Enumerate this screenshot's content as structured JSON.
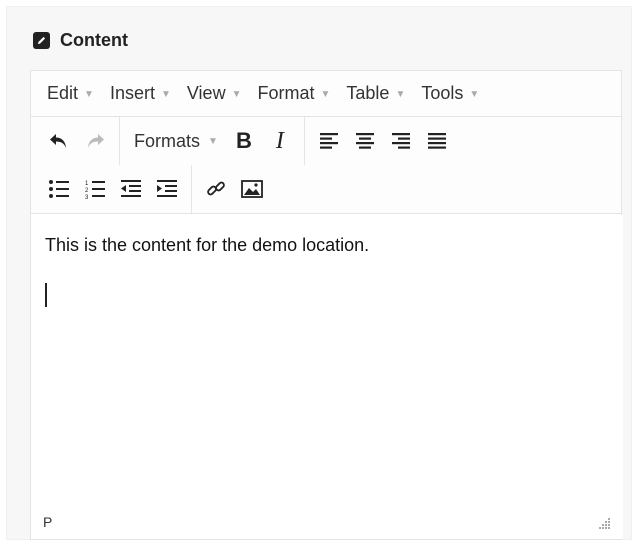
{
  "panel": {
    "title": "Content",
    "icon": "edit-square-icon"
  },
  "menubar": {
    "items": [
      {
        "label": "Edit"
      },
      {
        "label": "Insert"
      },
      {
        "label": "View"
      },
      {
        "label": "Format"
      },
      {
        "label": "Table"
      },
      {
        "label": "Tools"
      }
    ]
  },
  "toolbar": {
    "formats_label": "Formats",
    "bold_label": "B",
    "italic_label": "I",
    "icons": [
      "undo-icon",
      "redo-icon",
      "align-left-icon",
      "align-center-icon",
      "align-right-icon",
      "align-justify-icon",
      "bullet-list-icon",
      "numbered-list-icon",
      "outdent-icon",
      "indent-icon",
      "link-icon",
      "image-icon"
    ]
  },
  "content": {
    "paragraph": "This is the content for the demo location."
  },
  "statusbar": {
    "path": "P"
  },
  "colors": {
    "icon": "#222222",
    "border": "#e4e4e4",
    "disabled": "#999999"
  }
}
